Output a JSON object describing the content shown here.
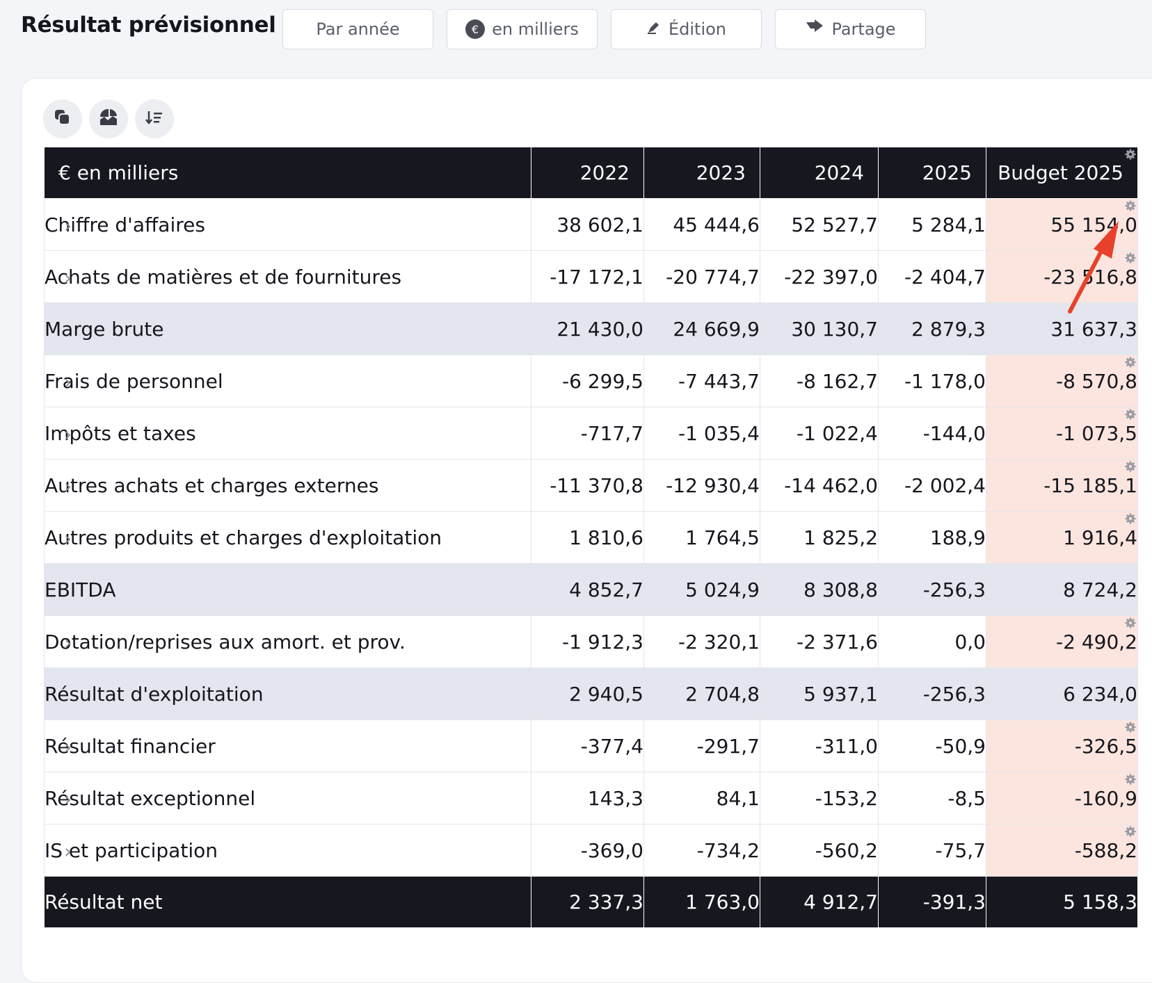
{
  "header": {
    "title": "Résultat prévisionnel",
    "buttons": {
      "period": "Par année",
      "units": "en milliers",
      "edit": "Édition",
      "share": "Partage"
    }
  },
  "toolbar": {
    "icons": [
      "copy-icon",
      "chart-icon",
      "sort-icon"
    ]
  },
  "table": {
    "header_label": "€ en milliers",
    "col_2022": "2022",
    "col_2023": "2023",
    "col_2024": "2024",
    "col_2025": "2025",
    "col_budget": "Budget 2025",
    "rows": [
      {
        "label": "Chiffre d'affaires",
        "v2022": "38 602,1",
        "v2023": "45 444,6",
        "v2024": "52 527,7",
        "v2025": "5 284,1",
        "budget": "55 154,0"
      },
      {
        "label": "Achats de matières et de fournitures",
        "v2022": "-17 172,1",
        "v2023": "-20 774,7",
        "v2024": "-22 397,0",
        "v2025": "-2 404,7",
        "budget": "-23 516,8"
      },
      {
        "label": "Marge brute",
        "v2022": "21 430,0",
        "v2023": "24 669,9",
        "v2024": "30 130,7",
        "v2025": "2 879,3",
        "budget": "31 637,3"
      },
      {
        "label": "Frais de personnel",
        "v2022": "-6 299,5",
        "v2023": "-7 443,7",
        "v2024": "-8 162,7",
        "v2025": "-1 178,0",
        "budget": "-8 570,8"
      },
      {
        "label": "Impôts et taxes",
        "v2022": "-717,7",
        "v2023": "-1 035,4",
        "v2024": "-1 022,4",
        "v2025": "-144,0",
        "budget": "-1 073,5"
      },
      {
        "label": "Autres achats et charges externes",
        "v2022": "-11 370,8",
        "v2023": "-12 930,4",
        "v2024": "-14 462,0",
        "v2025": "-2 002,4",
        "budget": "-15 185,1"
      },
      {
        "label": "Autres produits et charges d'exploitation",
        "v2022": "1 810,6",
        "v2023": "1 764,5",
        "v2024": "1 825,2",
        "v2025": "188,9",
        "budget": "1 916,4"
      },
      {
        "label": "EBITDA",
        "v2022": "4 852,7",
        "v2023": "5 024,9",
        "v2024": "8 308,8",
        "v2025": "-256,3",
        "budget": "8 724,2"
      },
      {
        "label": "Dotation/reprises aux amort. et prov.",
        "v2022": "-1 912,3",
        "v2023": "-2 320,1",
        "v2024": "-2 371,6",
        "v2025": "0,0",
        "budget": "-2 490,2"
      },
      {
        "label": "Résultat d'exploitation",
        "v2022": "2 940,5",
        "v2023": "2 704,8",
        "v2024": "5 937,1",
        "v2025": "-256,3",
        "budget": "6 234,0"
      },
      {
        "label": "Résultat financier",
        "v2022": "-377,4",
        "v2023": "-291,7",
        "v2024": "-311,0",
        "v2025": "-50,9",
        "budget": "-326,5"
      },
      {
        "label": "Résultat exceptionnel",
        "v2022": "143,3",
        "v2023": "84,1",
        "v2024": "-153,2",
        "v2025": "-8,5",
        "budget": "-160,9"
      },
      {
        "label": "IS et participation",
        "v2022": "-369,0",
        "v2023": "-734,2",
        "v2024": "-560,2",
        "v2025": "-75,7",
        "budget": "-588,2"
      },
      {
        "label": "Résultat net",
        "v2022": "2 337,3",
        "v2023": "1 763,0",
        "v2024": "4 912,7",
        "v2025": "-391,3",
        "budget": "5 158,3"
      }
    ]
  },
  "colors": {
    "header_bg": "#16171f",
    "budget_bg": "#fbe5de",
    "subtotal_bg": "#e3e6ee",
    "arrow": "#e8412b"
  }
}
